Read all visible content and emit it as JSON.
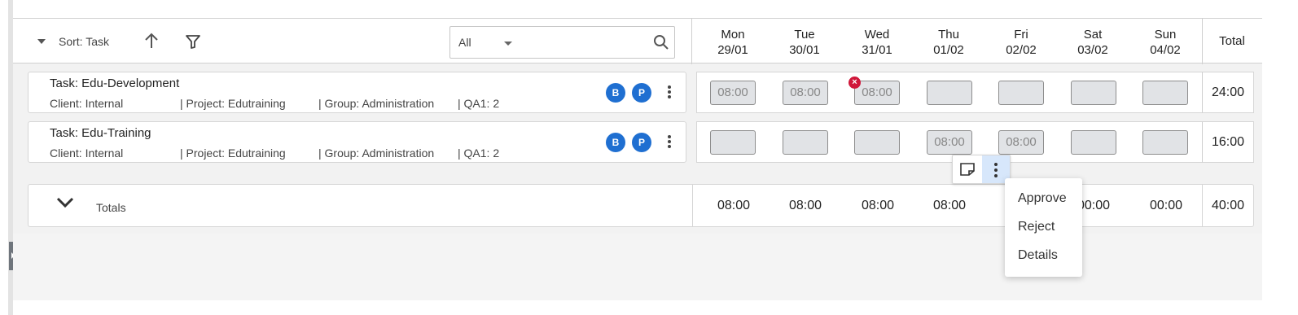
{
  "toolbar": {
    "sort_label": "Sort: Task",
    "filter_value": "All"
  },
  "days": [
    {
      "name": "Mon",
      "date": "29/01"
    },
    {
      "name": "Tue",
      "date": "30/01"
    },
    {
      "name": "Wed",
      "date": "31/01"
    },
    {
      "name": "Thu",
      "date": "01/02"
    },
    {
      "name": "Fri",
      "date": "02/02"
    },
    {
      "name": "Sat",
      "date": "03/02"
    },
    {
      "name": "Sun",
      "date": "04/02"
    }
  ],
  "total_header": "Total",
  "tasks": [
    {
      "title": "Task: Edu-Development",
      "client": "Client: Internal",
      "project": "| Project: Edutraining",
      "group": "| Group: Administration",
      "qa": "| QA1: 2",
      "badges": [
        "B",
        "P"
      ],
      "hours": [
        "08:00",
        "08:00",
        "08:00",
        "",
        "",
        "",
        ""
      ],
      "total": "24:00"
    },
    {
      "title": "Task: Edu-Training",
      "client": "Client: Internal",
      "project": "| Project: Edutraining",
      "group": "| Group: Administration",
      "qa": "| QA1: 2",
      "badges": [
        "B",
        "P"
      ],
      "hours": [
        "",
        "",
        "",
        "08:00",
        "08:00",
        "",
        ""
      ],
      "total": "16:00"
    }
  ],
  "totals": {
    "label": "Totals",
    "values": [
      "08:00",
      "08:00",
      "08:00",
      "08:00",
      "",
      "00:00",
      "00:00"
    ],
    "grand_total": "40:00"
  },
  "context_menu": {
    "items": [
      "Approve",
      "Reject",
      "Details"
    ]
  },
  "colors": {
    "badge": "#1f6fd1",
    "error": "#d0173a",
    "active_action": "#d7e7fb"
  },
  "icons": [
    "sort-caret-icon",
    "arrow-up-icon",
    "filter-icon",
    "search-icon",
    "kebab-menu-icon",
    "error-icon",
    "note-icon",
    "chevron-down-icon"
  ]
}
